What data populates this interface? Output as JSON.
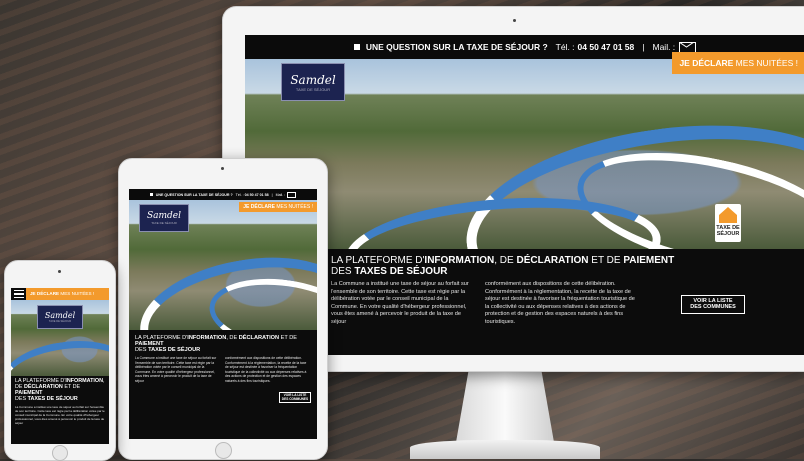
{
  "topbar": {
    "question": "UNE QUESTION SUR LA TAXE DE SÉJOUR ?",
    "phone_label": "Tél. :",
    "phone": "04 50 47 01 58",
    "separator": "|",
    "mail_label": "Mail. :"
  },
  "cta": {
    "strong": "JE DÉCLARE",
    "rest": " MES NUITÉES !"
  },
  "logo": {
    "name": "Samdel",
    "sub": "TAXE DE SÉJOUR"
  },
  "badge": {
    "line1": "TAXE DE",
    "line2": "SÉJOUR"
  },
  "headline": {
    "part1": "LA PLATEFORME D'",
    "b1": "INFORMATION",
    "part2": ", DE ",
    "b2": "DÉCLARATION",
    "part3": " ET DE ",
    "b3": "PAIEMENT",
    "part4": "DES ",
    "b4": "TAXES DE SÉJOUR"
  },
  "body": {
    "col1": "La Commune  a institué une taxe de séjour au forfait sur l'ensemble de son territoire. Cette taxe est régie par la délibération votée par le conseil municipal de la Commune. En votre qualité d'hébergeur professionnel, vous êtes amené à percevoir le produit de la taxe de séjour",
    "col2": "conformément aux dispositions de cette délibération. Conformément à la réglementation, la recette de la taxe de séjour est destinée à favoriser la fréquentation touristique de la collectivité ou aux dépenses relatives à des actions de protection et de gestion des espaces naturels à des fins touristiques."
  },
  "list_button": {
    "line1": "VOIR LA LISTE",
    "line2": "DES COMMUNES"
  },
  "colors": {
    "accent": "#f39a2c",
    "dark": "#0c0c0c"
  },
  "icons": [
    "mail-icon",
    "menu-icon",
    "square-bullet-icon",
    "home-button-icon"
  ]
}
